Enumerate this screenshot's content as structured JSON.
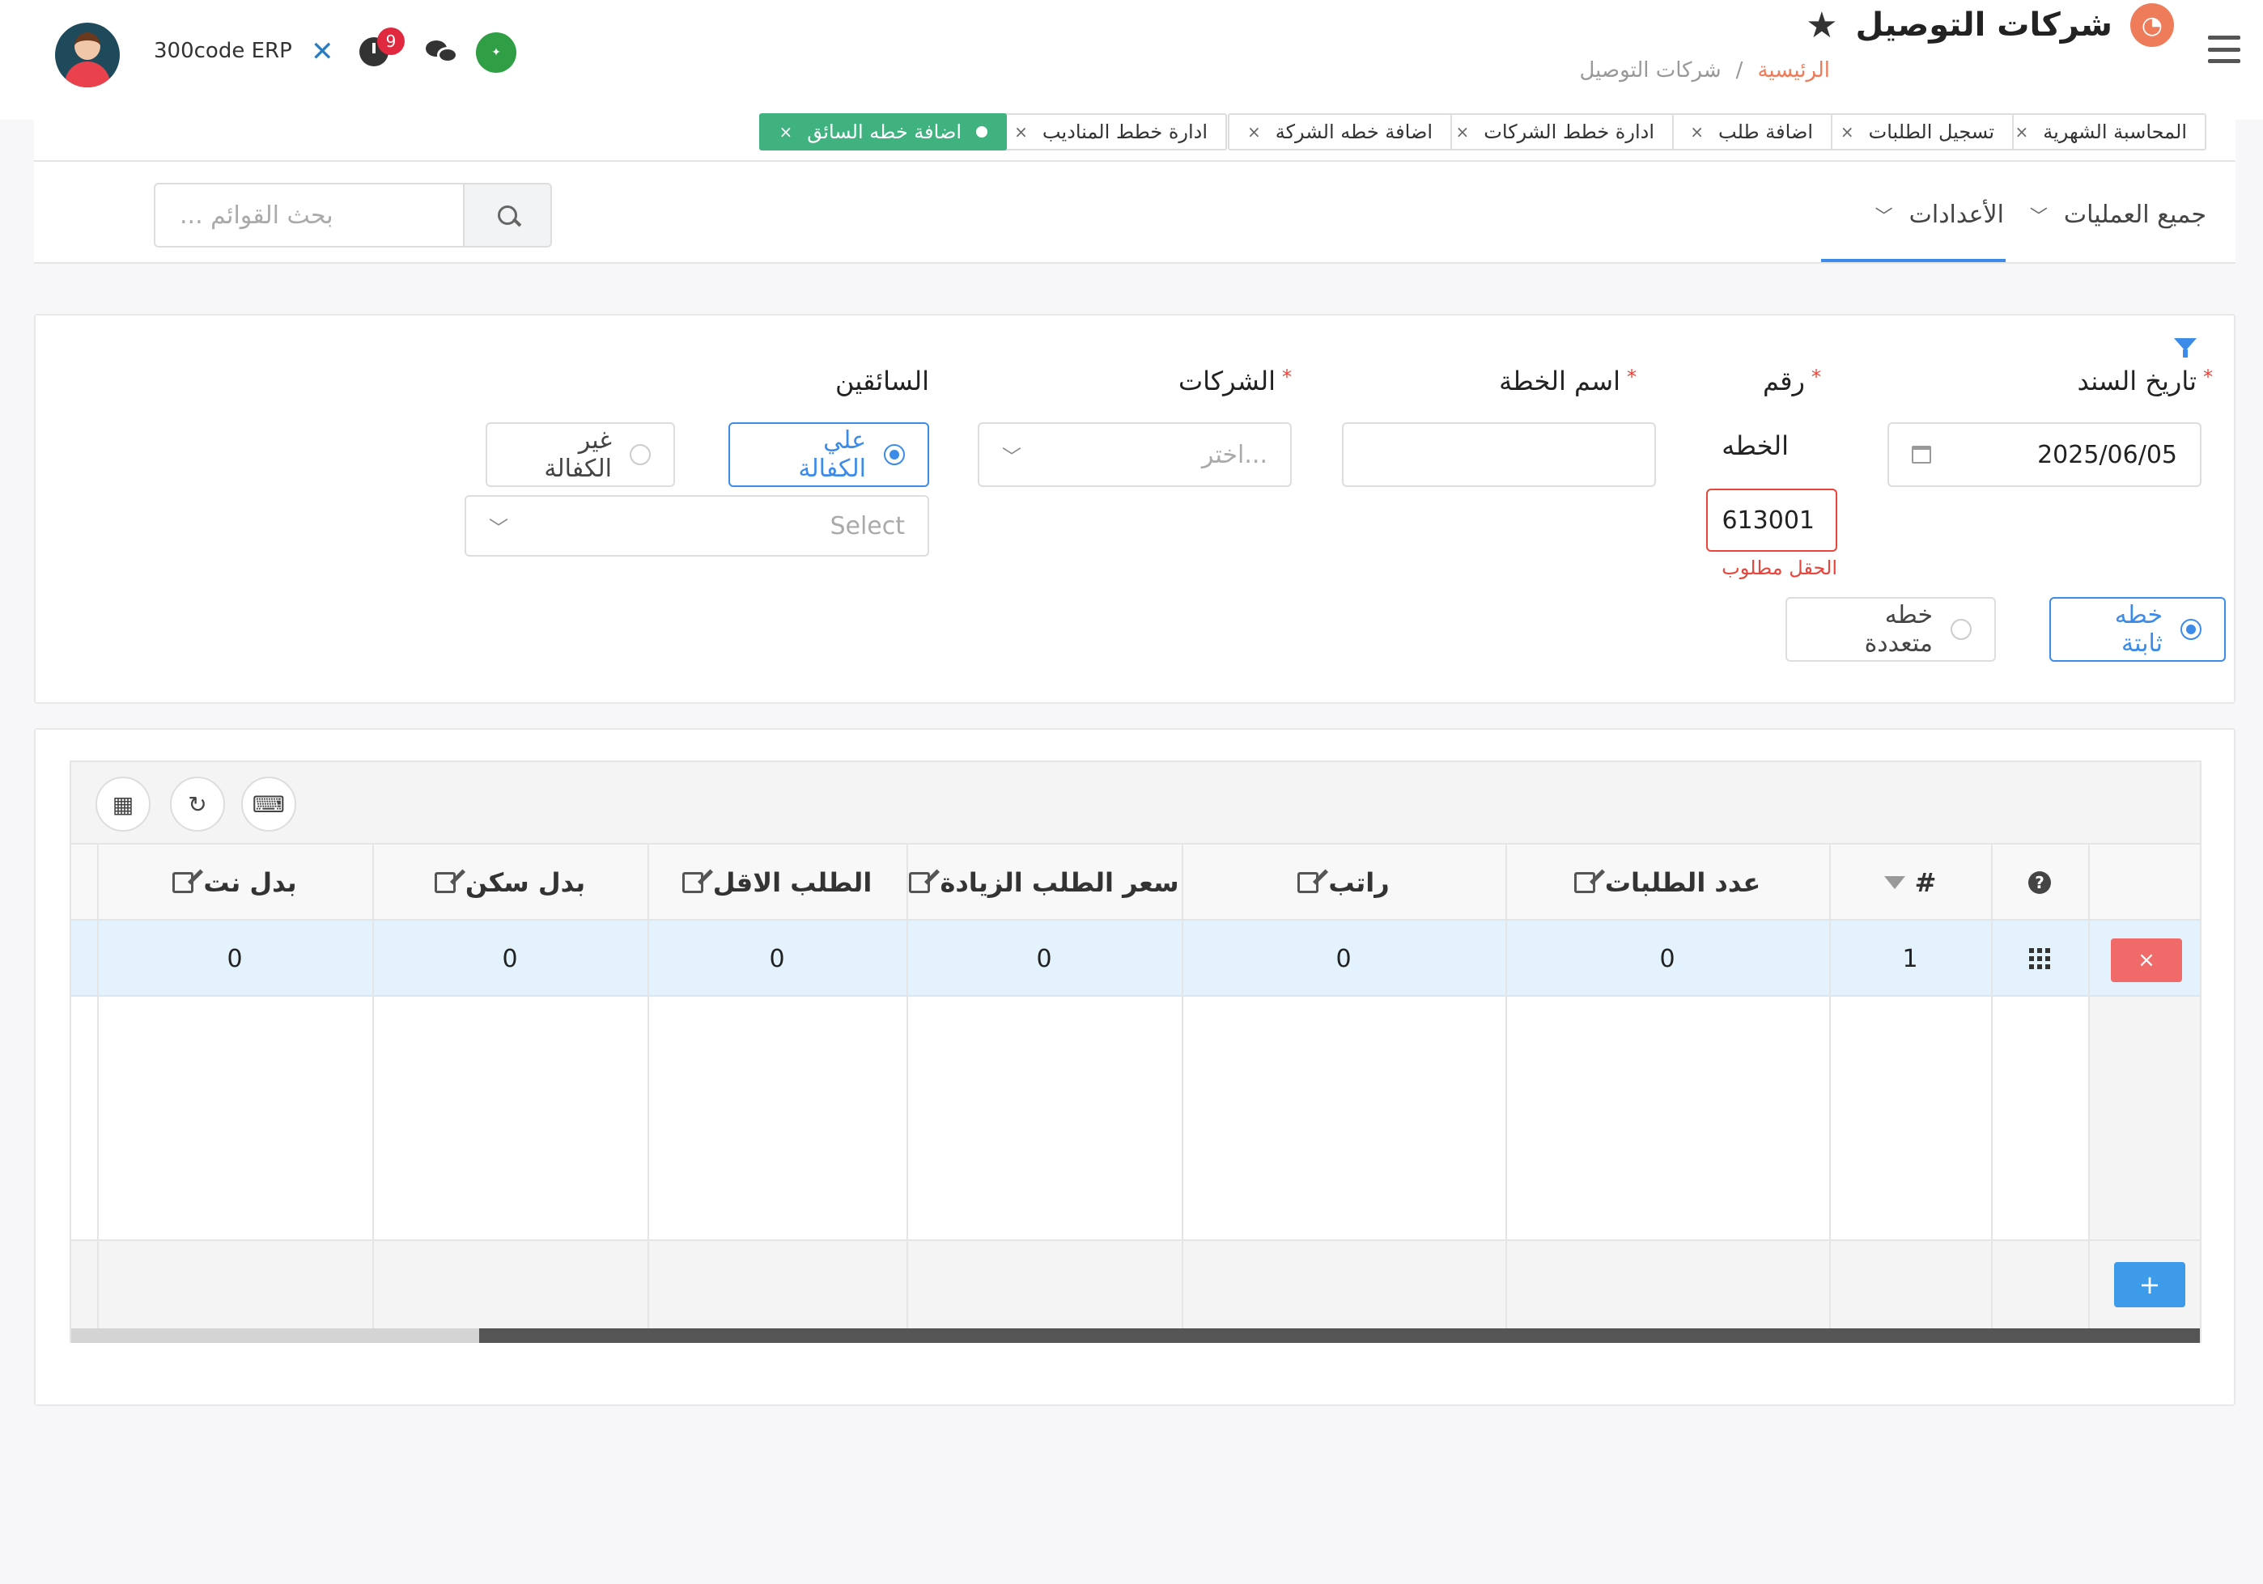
{
  "header": {
    "page_title": "شركات التوصيل",
    "breadcrumb_home": "الرئيسية",
    "breadcrumb_sep": "/",
    "breadcrumb_current": "شركات التوصيل",
    "app_name": "300code ERP",
    "notification_count": "9"
  },
  "tabs": [
    {
      "label": "المحاسبة الشهرية",
      "active": false
    },
    {
      "label": "تسجيل الطلبات",
      "active": false
    },
    {
      "label": "اضافة طلب",
      "active": false
    },
    {
      "label": "ادارة خطط الشركات",
      "active": false
    },
    {
      "label": "اضافة خطه الشركة",
      "active": false
    },
    {
      "label": "ادارة خطط المناديب",
      "active": false
    },
    {
      "label": "اضافة خطه السائق",
      "active": true
    }
  ],
  "tab_close": "×",
  "nav": {
    "all_operations": "جميع العمليات",
    "settings": "الأعدادات",
    "search_placeholder": "بحث القوائم ..."
  },
  "form": {
    "doc_date_label": "تاريخ السند",
    "doc_date_value": "2025/06/05",
    "plan_number_label_1": "رقم",
    "plan_number_label_2": "الخطه",
    "plan_number_value": "613001",
    "plan_number_error": "الحقل مطلوب",
    "plan_name_label": "اسم الخطة",
    "plan_name_value": "",
    "companies_label": "الشركات",
    "companies_placeholder": "اختر...",
    "drivers_label": "السائقين",
    "sponsorship_on": "علي الكفالة",
    "sponsorship_off": "غير الكفالة",
    "drivers_select_placeholder": "Select",
    "plan_type_fixed": "خطه ثابتة",
    "plan_type_multi": "خطه متعددة",
    "required_mark": "*"
  },
  "grid": {
    "columns": [
      "#",
      "عدد الطلبات",
      "راتب",
      "سعر الطلب الزيادة",
      "الطلب الاقل",
      "بدل سكن",
      "بدل نت"
    ],
    "rows": [
      {
        "index": "1",
        "orders_count": "0",
        "salary": "0",
        "extra_order_price": "0",
        "min_order": "0",
        "housing": "0",
        "internet": "0"
      }
    ],
    "delete_label": "×",
    "add_label": "+",
    "help_label": "?"
  },
  "colors": {
    "accent": "#3d8be8",
    "active_tab": "#3fb27f",
    "error": "#e8453c",
    "delete": "#f06a6a",
    "title_icon": "#ee7b5a"
  }
}
